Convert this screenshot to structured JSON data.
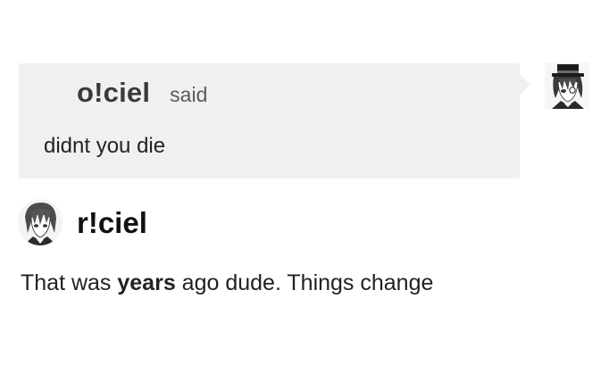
{
  "ask": {
    "asker_name": "o!ciel",
    "said_label": "said",
    "question": "didnt you die",
    "asker_avatar_icon": "anime-avatar-top-hat-icon"
  },
  "answer": {
    "answerer_name": "r!ciel",
    "answerer_avatar_icon": "anime-avatar-icon",
    "text_before": "That was ",
    "text_emphasis": "years",
    "text_after": " ago dude. Things change"
  },
  "colors": {
    "ask_background": "#f0f0f0",
    "page_background": "#ffffff"
  }
}
